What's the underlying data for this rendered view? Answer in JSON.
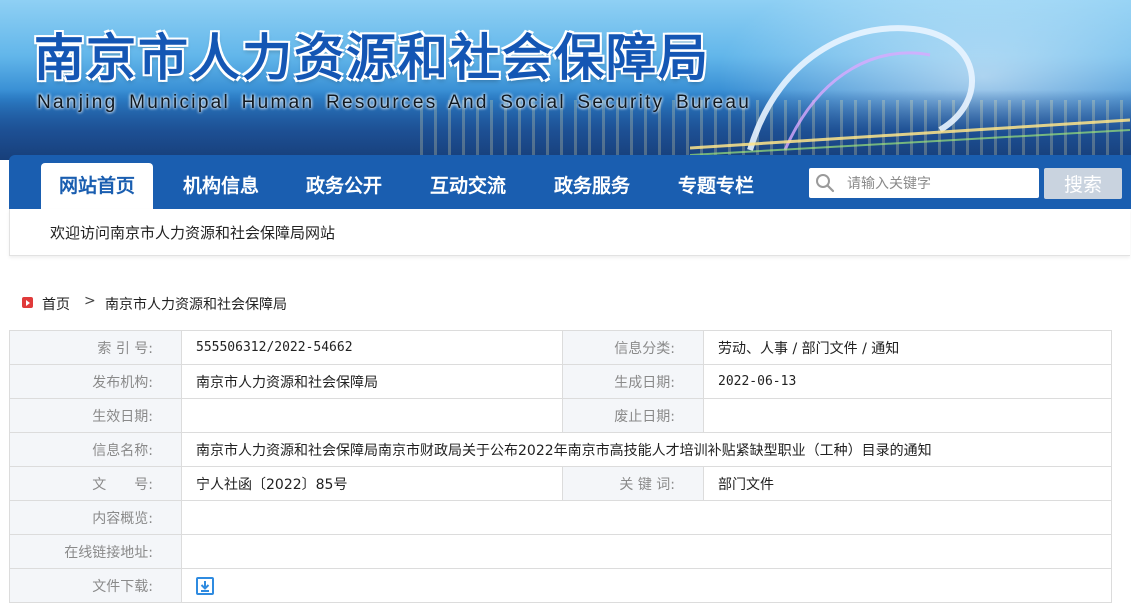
{
  "header": {
    "title_cn": "南京市人力资源和社会保障局",
    "title_en": "Nanjing Municipal Human Resources And Social Security Bureau"
  },
  "nav": {
    "items": [
      {
        "label": "网站首页",
        "active": true
      },
      {
        "label": "机构信息",
        "active": false
      },
      {
        "label": "政务公开",
        "active": false
      },
      {
        "label": "互动交流",
        "active": false
      },
      {
        "label": "政务服务",
        "active": false
      },
      {
        "label": "专题专栏",
        "active": false
      }
    ],
    "search_placeholder": "请输入关键字",
    "search_button": "搜索"
  },
  "welcome": "欢迎访问南京市人力资源和社会保障局网站",
  "breadcrumb": {
    "home": "首页",
    "separator": ">",
    "current": "南京市人力资源和社会保障局"
  },
  "info": {
    "index_label": "索 引 号:",
    "index_value": "555506312/2022-54662",
    "category_label": "信息分类:",
    "category_value": "劳动、人事 / 部门文件 / 通知",
    "publisher_label": "发布机构:",
    "publisher_value": "南京市人力资源和社会保障局",
    "created_label": "生成日期:",
    "created_value": "2022-06-13",
    "effective_label": "生效日期:",
    "effective_value": "",
    "expired_label": "废止日期:",
    "expired_value": "",
    "name_label": "信息名称:",
    "name_value": "南京市人力资源和社会保障局南京市财政局关于公布2022年南京市高技能人才培训补贴紧缺型职业（工种）目录的通知",
    "docno_label": "文　　号:",
    "docno_value": "宁人社函〔2022〕85号",
    "keywords_label": "关 键 词:",
    "keywords_value": "部门文件",
    "summary_label": "内容概览:",
    "summary_value": "",
    "link_label": "在线链接地址:",
    "link_value": "",
    "download_label": "文件下载:"
  },
  "colors": {
    "nav_blue": "#1a5eb0",
    "title_blue": "#1456b4",
    "label_gray": "#8a8a8a",
    "home_icon_red": "#e03a3a",
    "download_icon_blue": "#2f8be0"
  }
}
